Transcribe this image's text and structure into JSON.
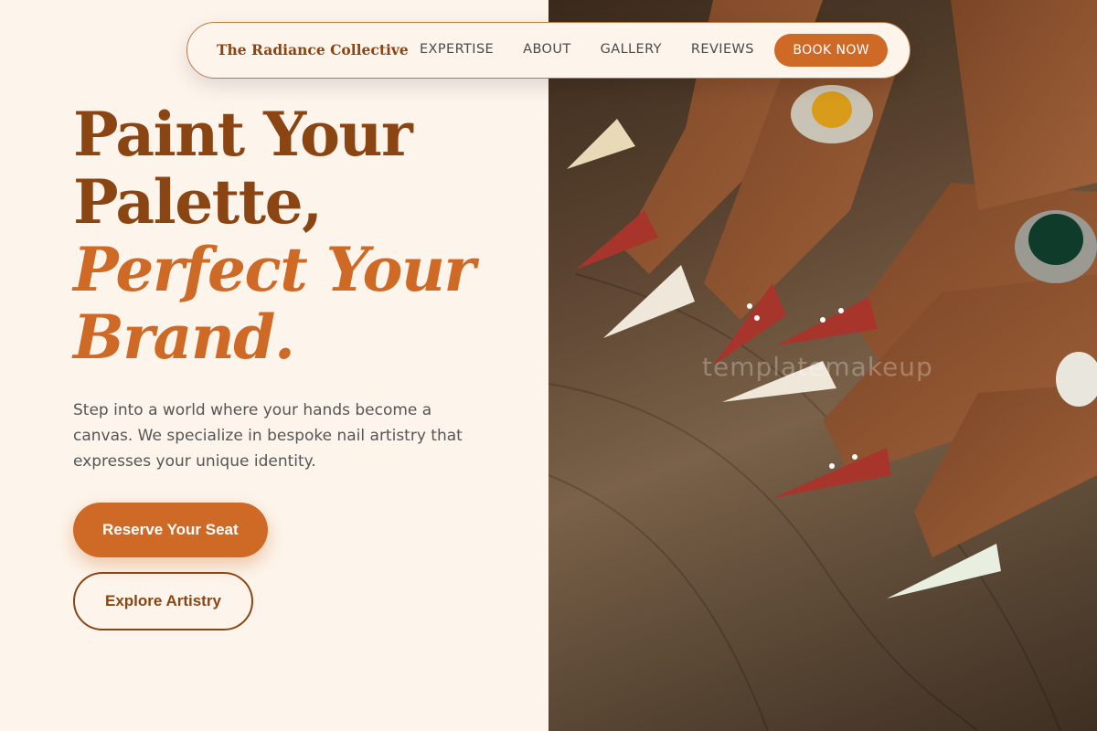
{
  "nav": {
    "brand": "The Radiance Collective",
    "links": [
      "EXPERTISE",
      "ABOUT",
      "GALLERY",
      "REVIEWS"
    ],
    "cta": "BOOK NOW"
  },
  "hero": {
    "line1": "Paint Your",
    "line2": "Palette,",
    "line3": "Perfect Your",
    "line4": "Brand.",
    "lead": "Step into a world where your hands become a canvas. We specialize in bespoke nail artistry that expresses your unique identity.",
    "primary_cta": "Reserve Your Seat",
    "secondary_cta": "Explore Artistry"
  },
  "photo": {
    "watermark": "templatemakeup"
  },
  "colors": {
    "brand_brown": "#8b4513",
    "accent_orange": "#cf6a26",
    "background_cream": "#fdf5ec"
  }
}
